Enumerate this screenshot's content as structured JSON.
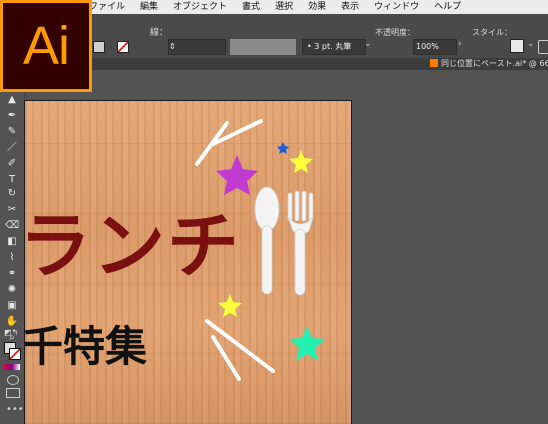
{
  "app": {
    "logo_text": "Ai"
  },
  "menubar": {
    "items": [
      "ファイル",
      "編集",
      "オブジェクト",
      "書式",
      "選択",
      "効果",
      "表示",
      "ウィンドウ",
      "ヘルプ"
    ]
  },
  "control_bar": {
    "stroke_label": "線：",
    "stroke_profile": "3 pt. 丸筆",
    "opacity_label": "不透明度：",
    "opacity_value": "100%",
    "style_label": "スタイル："
  },
  "document_tab": {
    "title": "同じ位置にペースト.ai* @ 66"
  },
  "artwork": {
    "headline": "ランチ",
    "subline": "千特集",
    "colors": {
      "headline": "#7a1010",
      "star_magenta": "#c23bd0",
      "star_yellow": "#ffff3c",
      "star_blue": "#1f5fd6",
      "star_teal": "#22f0b0",
      "utensil": "#f4f4f4"
    }
  },
  "icons": {
    "tools": [
      "selection-tool-icon",
      "direct-selection-tool-icon",
      "pen-tool-icon",
      "curvature-tool-icon",
      "line-tool-icon",
      "brush-tool-icon",
      "type-tool-icon",
      "rotate-tool-icon",
      "scissors-tool-icon",
      "eraser-tool-icon",
      "rectangle-tool-icon",
      "eyedropper-tool-icon",
      "blend-tool-icon",
      "symbol-sprayer-icon",
      "perspective-grid-icon",
      "artboard-tool-icon",
      "hand-tool-icon",
      "zoom-tool-icon"
    ]
  }
}
